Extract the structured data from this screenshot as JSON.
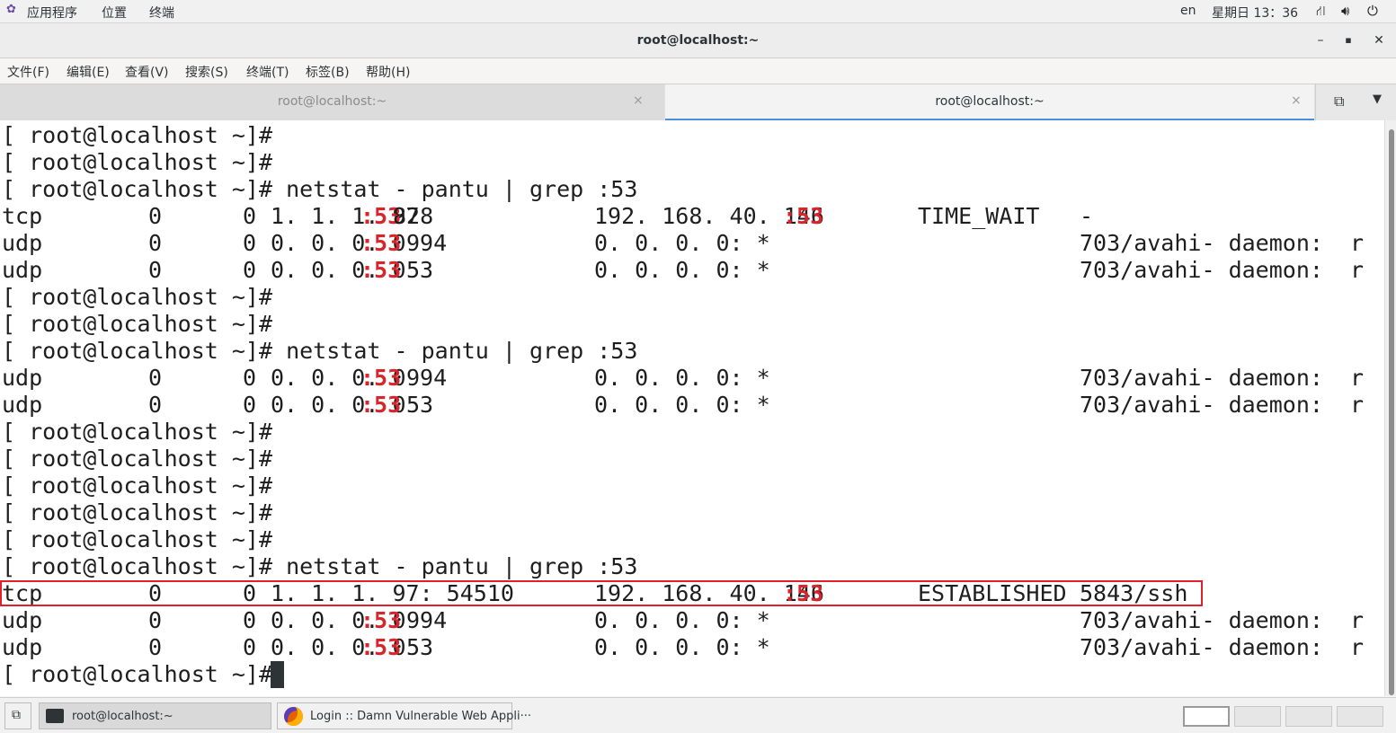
{
  "topbar": {
    "apps_label": "应用程序",
    "places_label": "位置",
    "active_app_label": "终端",
    "input_method": "en",
    "clock": "星期日 13：36"
  },
  "window": {
    "title": "root@localhost:~",
    "min_glyph": "–",
    "max_glyph": "▪",
    "close_glyph": "✕"
  },
  "menubar": {
    "items": [
      "文件(F)",
      "编辑(E)",
      "查看(V)",
      "搜索(S)",
      "终端(T)",
      "标签(B)",
      "帮助(H)"
    ]
  },
  "tabs": [
    {
      "label": "root@localhost:~",
      "active": false
    },
    {
      "label": "root@localhost:~",
      "active": true
    }
  ],
  "tab_close_glyph": "×",
  "highlight_color": "#e0202a",
  "accent_color": "#d8242a",
  "terminal": {
    "lines": [
      [
        {
          "t": "[ root@localhost ~]#"
        }
      ],
      [
        {
          "t": "[ root@localhost ~]#"
        }
      ],
      [
        {
          "t": "[ root@localhost ~]# netstat - pantu | grep :53"
        }
      ],
      [
        {
          "t": "tcp"
        },
        {
          "t": "0"
        },
        {
          "t": "0"
        },
        {
          "t": "1. 1. 1. 97"
        },
        {
          "t": ":53",
          "r": true
        },
        {
          "t": "828"
        },
        {
          "t": "192. 168. 40. 146"
        },
        {
          "t": ":53",
          "r": true
        },
        {
          "t": "TIME_WAIT"
        },
        {
          "t": "-"
        }
      ],
      [
        {
          "t": "udp"
        },
        {
          "t": "0"
        },
        {
          "t": "0"
        },
        {
          "t": "0. 0. 0. 0"
        },
        {
          "t": ":53",
          "r": true
        },
        {
          "t": "994"
        },
        {
          "t": "0. 0. 0. 0: *"
        },
        {
          "t": ""
        },
        {
          "t": ""
        },
        {
          "t": "703/avahi- daemon:  r"
        }
      ],
      [
        {
          "t": "udp"
        },
        {
          "t": "0"
        },
        {
          "t": "0"
        },
        {
          "t": "0. 0. 0. 0"
        },
        {
          "t": ":53",
          "r": true
        },
        {
          "t": "53"
        },
        {
          "t": "0. 0. 0. 0: *"
        },
        {
          "t": ""
        },
        {
          "t": ""
        },
        {
          "t": "703/avahi- daemon:  r"
        }
      ],
      [
        {
          "t": "[ root@localhost ~]#"
        }
      ],
      [
        {
          "t": "[ root@localhost ~]#"
        }
      ],
      [
        {
          "t": "[ root@localhost ~]# netstat - pantu | grep :53"
        }
      ],
      [
        {
          "t": "udp"
        },
        {
          "t": "0"
        },
        {
          "t": "0"
        },
        {
          "t": "0. 0. 0. 0"
        },
        {
          "t": ":53",
          "r": true
        },
        {
          "t": "994"
        },
        {
          "t": "0. 0. 0. 0: *"
        },
        {
          "t": ""
        },
        {
          "t": ""
        },
        {
          "t": "703/avahi- daemon:  r"
        }
      ],
      [
        {
          "t": "udp"
        },
        {
          "t": "0"
        },
        {
          "t": "0"
        },
        {
          "t": "0. 0. 0. 0"
        },
        {
          "t": ":53",
          "r": true
        },
        {
          "t": "53"
        },
        {
          "t": "0. 0. 0. 0: *"
        },
        {
          "t": ""
        },
        {
          "t": ""
        },
        {
          "t": "703/avahi- daemon:  r"
        }
      ],
      [
        {
          "t": "[ root@localhost ~]#"
        }
      ],
      [
        {
          "t": "[ root@localhost ~]#"
        }
      ],
      [
        {
          "t": "[ root@localhost ~]#"
        }
      ],
      [
        {
          "t": "[ root@localhost ~]#"
        }
      ],
      [
        {
          "t": "[ root@localhost ~]#"
        }
      ],
      [
        {
          "t": "[ root@localhost ~]# netstat - pantu | grep :53"
        }
      ],
      [
        {
          "t": "tcp"
        },
        {
          "t": "0"
        },
        {
          "t": "0"
        },
        {
          "t": "1. 1. 1. 97: 54510"
        },
        {
          "t": ""
        },
        {
          "t": ""
        },
        {
          "t": "192. 168. 40. 146"
        },
        {
          "t": ":53",
          "r": true
        },
        {
          "t": "ESTABLISHED"
        },
        {
          "t": "5843/ssh"
        }
      ],
      [
        {
          "t": "udp"
        },
        {
          "t": "0"
        },
        {
          "t": "0"
        },
        {
          "t": "0. 0. 0. 0"
        },
        {
          "t": ":53",
          "r": true
        },
        {
          "t": "994"
        },
        {
          "t": "0. 0. 0. 0: *"
        },
        {
          "t": ""
        },
        {
          "t": ""
        },
        {
          "t": "703/avahi- daemon:  r"
        }
      ],
      [
        {
          "t": "udp"
        },
        {
          "t": "0"
        },
        {
          "t": "0"
        },
        {
          "t": "0. 0. 0. 0"
        },
        {
          "t": ":53",
          "r": true
        },
        {
          "t": "53"
        },
        {
          "t": "0. 0. 0. 0: *"
        },
        {
          "t": ""
        },
        {
          "t": ""
        },
        {
          "t": "703/avahi- daemon:  r"
        }
      ],
      [
        {
          "t": "[ root@localhost ~]#"
        }
      ]
    ]
  },
  "taskbar": {
    "items": [
      {
        "label": "root@localhost:~",
        "icon": "terminal-icon"
      },
      {
        "label": "Login :: Damn Vulnerable Web Appli···",
        "icon": "firefox-icon"
      }
    ]
  }
}
